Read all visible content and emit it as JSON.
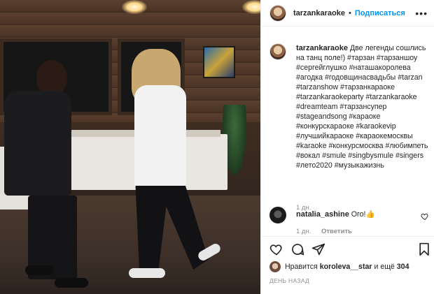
{
  "post": {
    "username": "tarzankaraoke",
    "follow_label": "Подписаться",
    "separator": "•",
    "more_label": "•••"
  },
  "caption": {
    "username": "tarzankaraoke",
    "text": "Две легенды сошлись на танц поле!) #тарзан #тарзаншоу #сергейглушко #наташакоролева #агодка #годовщинасвадьбы #tarzan #tarzanshow #тарзанкараоке #tarzankaraokeparty #tarzankaraoke #dreamteam #тарзансупер #stageandsong #караоке #конкурскараоке #karaokevip #лучшийкараоке #караокемосквы #karaoke #конкурсмосква #любимпеть #вокал #smule #singbysmule #singers #лето2020 #музыкажизнь",
    "time": "1 дн."
  },
  "comment": {
    "username": "natalia_ashine",
    "text": "Ого!👍",
    "time": "1 дн.",
    "reply_label": "Ответить"
  },
  "likes": {
    "prefix": "Нравится",
    "user": "koroleva__star",
    "middle": "и ещё",
    "count": "304"
  },
  "date": "ДЕНЬ НАЗАД",
  "icons": {
    "like": "heart-icon",
    "comment": "comment-icon",
    "share": "share-icon",
    "save": "bookmark-icon",
    "more": "more-icon"
  }
}
